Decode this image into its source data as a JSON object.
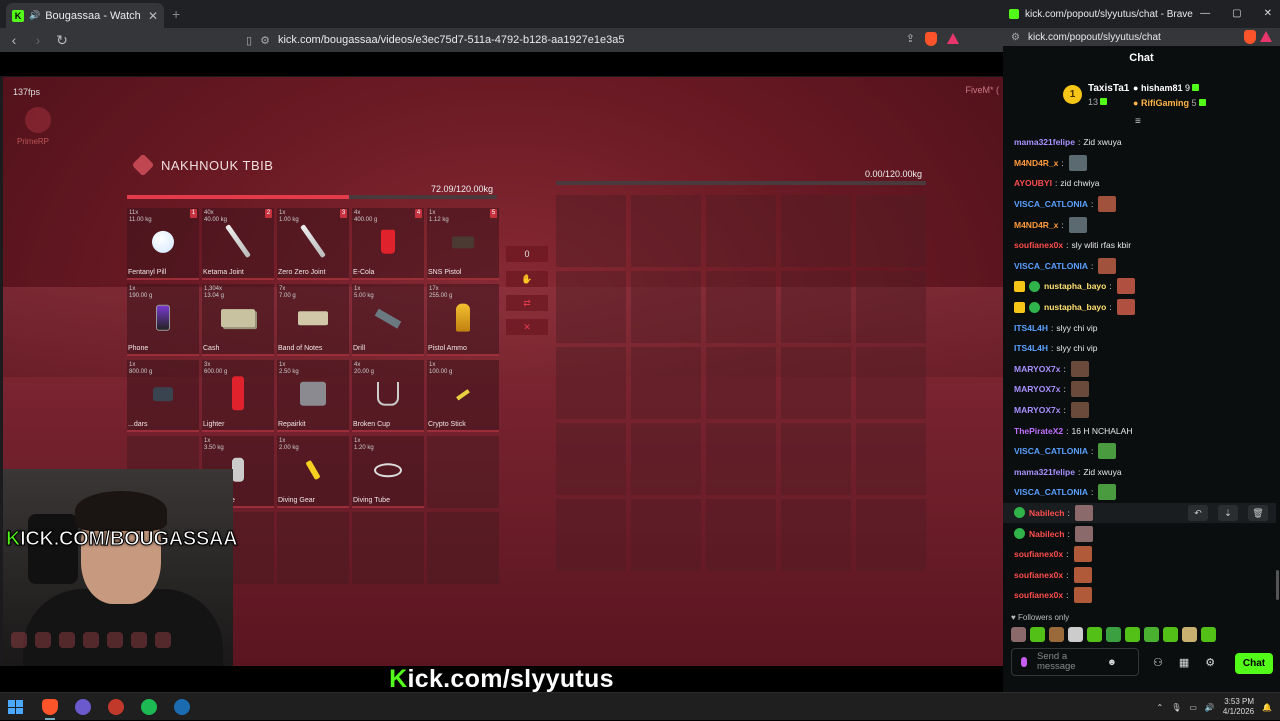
{
  "browser": {
    "tab_title": "Bougassaa - Watch the VOD",
    "tab_close": "✕",
    "new_tab": "+",
    "url": "kick.com/bougassaa/videos/e3ec75d7-511a-4792-b128-aa1927e1e3a5"
  },
  "game": {
    "fps": "137fps",
    "fivem": "FiveM* (",
    "faded_brand": "PrimeRP",
    "inventory_name": "NAKHNOUK TBIB",
    "left_weight": "72.09/120.00kg",
    "left_weight_fraction": 0.6,
    "right_weight": "0.00/120.00kg",
    "mid_amount": "0",
    "left_items": [
      {
        "label": "Fentanyl Pill",
        "count": "11x",
        "weight": "11.00 kg",
        "num": "1",
        "icon": "pill-icon"
      },
      {
        "label": "Ketama Joint",
        "count": "40x",
        "weight": "40.00 kg",
        "num": "2",
        "icon": "joint-icon"
      },
      {
        "label": "Zero Zero Joint",
        "count": "1x",
        "weight": "1.00 kg",
        "num": "3",
        "icon": "joint-icon"
      },
      {
        "label": "E-Cola",
        "count": "4x",
        "weight": "400.00 g",
        "num": "4",
        "icon": "cola-cup-icon"
      },
      {
        "label": "SNS Pistol",
        "count": "1x",
        "weight": "1.12 kg",
        "num": "5",
        "icon": "pistol-icon"
      },
      {
        "label": "Phone",
        "count": "1x",
        "weight": "190.00 g",
        "num": "",
        "icon": "phone-icon"
      },
      {
        "label": "Cash",
        "count": "1,304x",
        "weight": "13.04 g",
        "num": "",
        "icon": "cash-icon"
      },
      {
        "label": "Band of Notes",
        "count": "7x",
        "weight": "7.00 g",
        "num": "",
        "icon": "notes-icon"
      },
      {
        "label": "Drill",
        "count": "1x",
        "weight": "5.00 kg",
        "num": "",
        "icon": "drill-icon"
      },
      {
        "label": "Pistol Ammo",
        "count": "17x",
        "weight": "255.00 g",
        "num": "",
        "icon": "ammo-icon"
      },
      {
        "label": "...dars",
        "count": "1x",
        "weight": "800.00 g",
        "num": "",
        "icon": "radar-icon"
      },
      {
        "label": "Lighter",
        "count": "3x",
        "weight": "600.00 g",
        "num": "",
        "icon": "lighter-icon"
      },
      {
        "label": "Repairkit",
        "count": "1x",
        "weight": "2.50 kg",
        "num": "",
        "icon": "repairkit-icon"
      },
      {
        "label": "Broken Cup",
        "count": "4x",
        "weight": "20.00 g",
        "num": "",
        "icon": "broken-cup-icon"
      },
      {
        "label": "Crypto Stick",
        "count": "1x",
        "weight": "100.00 g",
        "num": "",
        "icon": "crypto-stick-icon"
      },
      {
        "label": "",
        "count": "",
        "weight": "",
        "num": "",
        "icon": ""
      },
      {
        "label": "Parachute",
        "count": "1x",
        "weight": "3.50 kg",
        "num": "",
        "icon": "parachute-icon"
      },
      {
        "label": "Diving Gear",
        "count": "1x",
        "weight": "2.00 kg",
        "num": "",
        "icon": "diving-gear-icon"
      },
      {
        "label": "Diving Tube",
        "count": "1x",
        "weight": "1.20 kg",
        "num": "",
        "icon": "diving-tube-icon"
      },
      {
        "label": "",
        "count": "",
        "weight": "",
        "num": "",
        "icon": ""
      }
    ],
    "overlay_url": "KICK.COM/BOUGASSAA",
    "bottom_url": "Kick.com/slyyutus"
  },
  "chat": {
    "window_title": "kick.com/popout/slyyutus/chat - Brave",
    "url": "kick.com/popout/slyyutus/chat",
    "label": "Chat",
    "leaders": [
      {
        "rank": "1",
        "name": "TaxisTa1",
        "value": "13"
      },
      {
        "name": "hisham81",
        "value": "9"
      },
      {
        "name": "RifiGaming",
        "value": "5"
      }
    ],
    "messages": [
      {
        "user": "mama321felipe",
        "text": "Zid xwuya",
        "color": "#a890ff",
        "emote": ""
      },
      {
        "user": "M4ND4R_x",
        "text": "",
        "color": "#ff9a3c",
        "emote": "#5a6a70"
      },
      {
        "user": "AYOUBYI",
        "text": "zid chwiya",
        "color": "#ff4d4d",
        "emote": ""
      },
      {
        "user": "VISCA_CATLONIA",
        "text": "",
        "color": "#5aa0ff",
        "emote": "#a0523d"
      },
      {
        "user": "M4ND4R_x",
        "text": "",
        "color": "#ff9a3c",
        "emote": "#5a6a70"
      },
      {
        "user": "soufianex0x",
        "text": "sly wliti rfas kbir",
        "color": "#ff4d4d",
        "emote": ""
      },
      {
        "user": "VISCA_CATLONIA",
        "text": "",
        "color": "#5aa0ff",
        "emote": "#a0523d"
      },
      {
        "user": "nustapha_bayo",
        "text": "",
        "color": "#ffe070",
        "emote": "#b05040",
        "badges": true
      },
      {
        "user": "nustapha_bayo",
        "text": "",
        "color": "#ffe070",
        "emote": "#b05040",
        "badges": true
      },
      {
        "user": "ITS4L4H",
        "text": "slyy chi vip",
        "color": "#5aa0ff",
        "emote": ""
      },
      {
        "user": "ITS4L4H",
        "text": "slyy chi vip",
        "color": "#5aa0ff",
        "emote": ""
      },
      {
        "user": "MARYOX7x",
        "text": "",
        "color": "#a890ff",
        "emote": "#6a4a3a"
      },
      {
        "user": "MARYOX7x",
        "text": "",
        "color": "#a890ff",
        "emote": "#6a4a3a"
      },
      {
        "user": "MARYOX7x",
        "text": "",
        "color": "#a890ff",
        "emote": "#6a4a3a"
      },
      {
        "user": "ThePirateX2",
        "text": "16 H NCHALAH",
        "color": "#c070ff",
        "emote": ""
      },
      {
        "user": "VISCA_CATLONIA",
        "text": "",
        "color": "#5aa0ff",
        "emote": "#4a9a40"
      },
      {
        "user": "mama321felipe",
        "text": "Zid xwuya",
        "color": "#a890ff",
        "emote": ""
      },
      {
        "user": "VISCA_CATLONIA",
        "text": "",
        "color": "#5aa0ff",
        "emote": "#4a9a40"
      },
      {
        "user": "Nabilech",
        "text": "",
        "color": "#ff4d4d",
        "emote": "#8a6a6a",
        "green_badge": true,
        "hover": true
      },
      {
        "user": "Nabilech",
        "text": "",
        "color": "#ff4d4d",
        "emote": "#8a6a6a",
        "green_badge": true
      },
      {
        "user": "soufianex0x",
        "text": "",
        "color": "#ff4d4d",
        "emote": "#b05a3a"
      },
      {
        "user": "soufianex0x",
        "text": "",
        "color": "#ff4d4d",
        "emote": "#b05a3a"
      },
      {
        "user": "soufianex0x",
        "text": "",
        "color": "#ff4d4d",
        "emote": "#b05a3a"
      }
    ],
    "followers_only": "Followers only",
    "input_placeholder": "Send a message",
    "send_button": "Chat"
  },
  "taskbar": {
    "time": "3:53 PM",
    "date": "4/1/2026"
  },
  "colors": {
    "kick_green": "#53fc18",
    "game_red": "#e23c4c"
  }
}
